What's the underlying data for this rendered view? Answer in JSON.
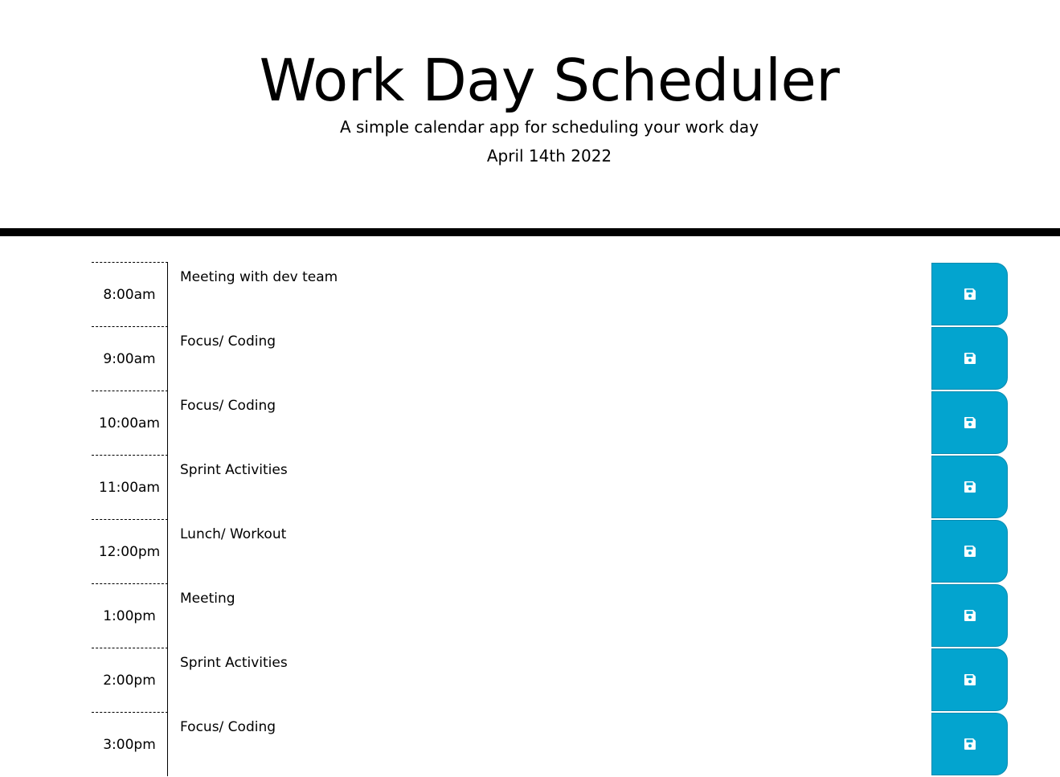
{
  "header": {
    "title": "Work Day Scheduler",
    "subtitle": "A simple calendar app for scheduling your work day",
    "date": "April 14th 2022"
  },
  "schedule": {
    "rows": [
      {
        "hour": "8:00am",
        "text": "Meeting with dev team",
        "icon": "save-icon"
      },
      {
        "hour": "9:00am",
        "text": "Focus/ Coding",
        "icon": "save-icon"
      },
      {
        "hour": "10:00am",
        "text": "Focus/ Coding",
        "icon": "save-icon"
      },
      {
        "hour": "11:00am",
        "text": "Sprint Activities",
        "icon": "save-icon"
      },
      {
        "hour": "12:00pm",
        "text": "Lunch/ Workout",
        "icon": "save-icon"
      },
      {
        "hour": "1:00pm",
        "text": "Meeting",
        "icon": "save-icon"
      },
      {
        "hour": "2:00pm",
        "text": "Sprint Activities",
        "icon": "save-icon"
      },
      {
        "hour": "3:00pm",
        "text": "Focus/ Coding",
        "icon": "save-icon"
      }
    ]
  },
  "colors": {
    "save_button": "#03a4cf",
    "divider": "#000000"
  }
}
